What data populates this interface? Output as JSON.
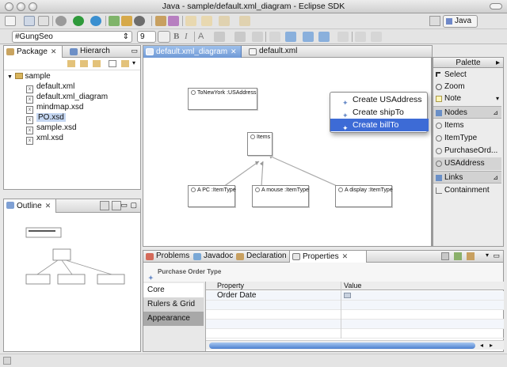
{
  "window": {
    "title": "Java - sample/default.xml_diagram - Eclipse SDK"
  },
  "toolbar2": {
    "font_name": "#GungSeo",
    "font_size": "9"
  },
  "perspective": {
    "label": "Java"
  },
  "left_panel": {
    "tabs": [
      {
        "label": "Package"
      },
      {
        "label": "Hierarch"
      }
    ],
    "tree": {
      "root": "sample",
      "items": [
        {
          "label": "default.xml",
          "icon": "x"
        },
        {
          "label": "default.xml_diagram",
          "icon": "x"
        },
        {
          "label": "mindmap.xsd",
          "icon": "x"
        },
        {
          "label": "PO.xsd",
          "icon": "x",
          "selected": true
        },
        {
          "label": "sample.xsd",
          "icon": "x"
        },
        {
          "label": "xml.xsd",
          "icon": "x"
        }
      ]
    }
  },
  "outline": {
    "tab_label": "Outline"
  },
  "editor": {
    "tabs": [
      {
        "label": "default.xml_diagram"
      },
      {
        "label": "default.xml"
      }
    ],
    "nodes": {
      "to_new_york": "ToNewYork :USAddress",
      "items": "Items",
      "pc": "A PC :ItemType",
      "mouse": "A mouse :ItemType",
      "display": "A display :ItemType"
    },
    "context_menu": [
      {
        "label": "Create USAddress"
      },
      {
        "label": "Create shipTo"
      },
      {
        "label": "Create billTo"
      }
    ]
  },
  "palette": {
    "title": "Palette",
    "items": [
      {
        "label": "Select"
      },
      {
        "label": "Zoom"
      },
      {
        "label": "Note"
      }
    ],
    "nodes_header": "Nodes",
    "nodes": [
      {
        "label": "Items"
      },
      {
        "label": "ItemType"
      },
      {
        "label": "PurchaseOrd..."
      },
      {
        "label": "USAddress"
      }
    ],
    "links_header": "Links",
    "links": [
      {
        "label": "Containment"
      }
    ]
  },
  "bottom_panel": {
    "tabs": [
      {
        "label": "Problems"
      },
      {
        "label": "Javadoc"
      },
      {
        "label": "Declaration"
      },
      {
        "label": "Properties"
      }
    ],
    "header": "Purchase Order Type",
    "categories": [
      {
        "label": "Core"
      },
      {
        "label": "Rulers & Grid"
      },
      {
        "label": "Appearance"
      }
    ],
    "columns": {
      "property": "Property",
      "value": "Value"
    },
    "rows": [
      {
        "property": "Order Date",
        "value": ""
      }
    ]
  },
  "colors": {
    "selection": "#3d6bd6",
    "tab_active": "#7fa6de"
  }
}
